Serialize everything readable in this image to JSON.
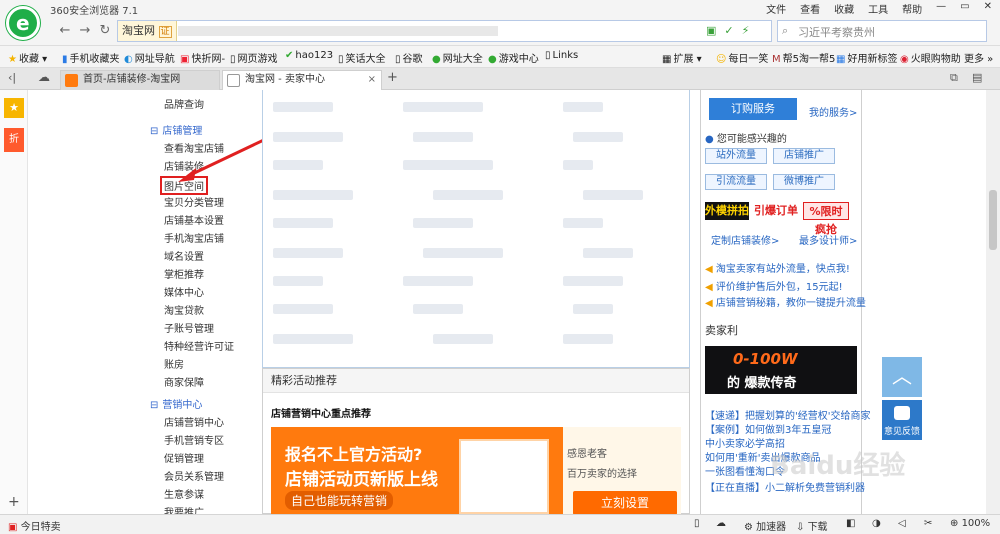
{
  "window": {
    "title": "360安全浏览器 7.1"
  },
  "menubar": [
    "文件",
    "查看",
    "收藏",
    "工具",
    "帮助"
  ],
  "address": {
    "site_label": "淘宝网",
    "cert_label": "证"
  },
  "search": {
    "placeholder": "习近平考察贵州"
  },
  "bookmarks": [
    "收藏",
    "手机收藏夹",
    "网址导航",
    "快折网-",
    "网页游戏",
    "hao123",
    "笑话大全",
    "谷歌",
    "网址大全",
    "游戏中心",
    "Links"
  ],
  "bookmarks_right": [
    "扩展",
    "每日一笑",
    "帮5淘一帮5",
    "好用新标签",
    "火眼购物助",
    "更多"
  ],
  "tabs": [
    {
      "label": "首页-店铺装修-淘宝网"
    },
    {
      "label": "淘宝网 - 卖家中心"
    }
  ],
  "sidemenu": {
    "top_item": "品牌查询",
    "shop_section": "店铺管理",
    "shop_items": [
      "查看淘宝店铺",
      "店铺装修",
      "图片空间",
      "宝贝分类管理",
      "店铺基本设置",
      "手机淘宝店铺",
      "域名设置",
      "掌柜推荐",
      "媒体中心",
      "淘宝贷款",
      "子账号管理",
      "特种经营许可证",
      "账房",
      "商家保障"
    ],
    "marketing_section": "营销中心",
    "marketing_items": [
      "店铺营销中心",
      "手机营销专区",
      "促销管理",
      "会员关系管理",
      "生意参谋",
      "我要推广"
    ]
  },
  "activity": {
    "header": "精彩活动推荐",
    "subheader": "店铺营销中心重点推荐",
    "banner": {
      "line1": "报名不上官方活动?",
      "line2": "店铺活动页新版上线",
      "line3": "自己也能玩转营销",
      "right_a": "感恩老客",
      "right_b": "百万卖家的选择",
      "button": "立刻设置"
    }
  },
  "rightpanel": {
    "order_button": "订购服务",
    "my_services": "我的服务>",
    "interest": "您可能感兴趣的",
    "chips": [
      "站外流量",
      "店铺推广",
      "引流流量",
      "微博推广"
    ],
    "promos": [
      "外模拼拍",
      "引爆订单",
      "%限时疯抢"
    ],
    "custom_decor": "定制店铺装修>",
    "best_design": "最多设计师>",
    "notices": [
      "淘宝卖家有站外流量，快点我!",
      "评价维护售后外包，15元起!",
      "店铺营销秘籍，教你一键提升流量"
    ],
    "seller_news": "卖家利",
    "ad_big": "0-100W",
    "ad_small": "的 爆款传奇",
    "news": [
      "【速递】把握划算的'经营权'交给商家",
      "【案例】如何做到3年五皇冠",
      "中小卖家必学高招",
      "如何用'重新'卖出爆款商品",
      "一张图看懂淘口令",
      "【正在直播】小二解析免费营销利器"
    ]
  },
  "float": {
    "feedback": "意见反馈"
  },
  "status": {
    "left": "今日特卖",
    "accelerator": "加速器",
    "download": "下载",
    "zoom": "100%"
  },
  "watermark": "Baidu经验"
}
